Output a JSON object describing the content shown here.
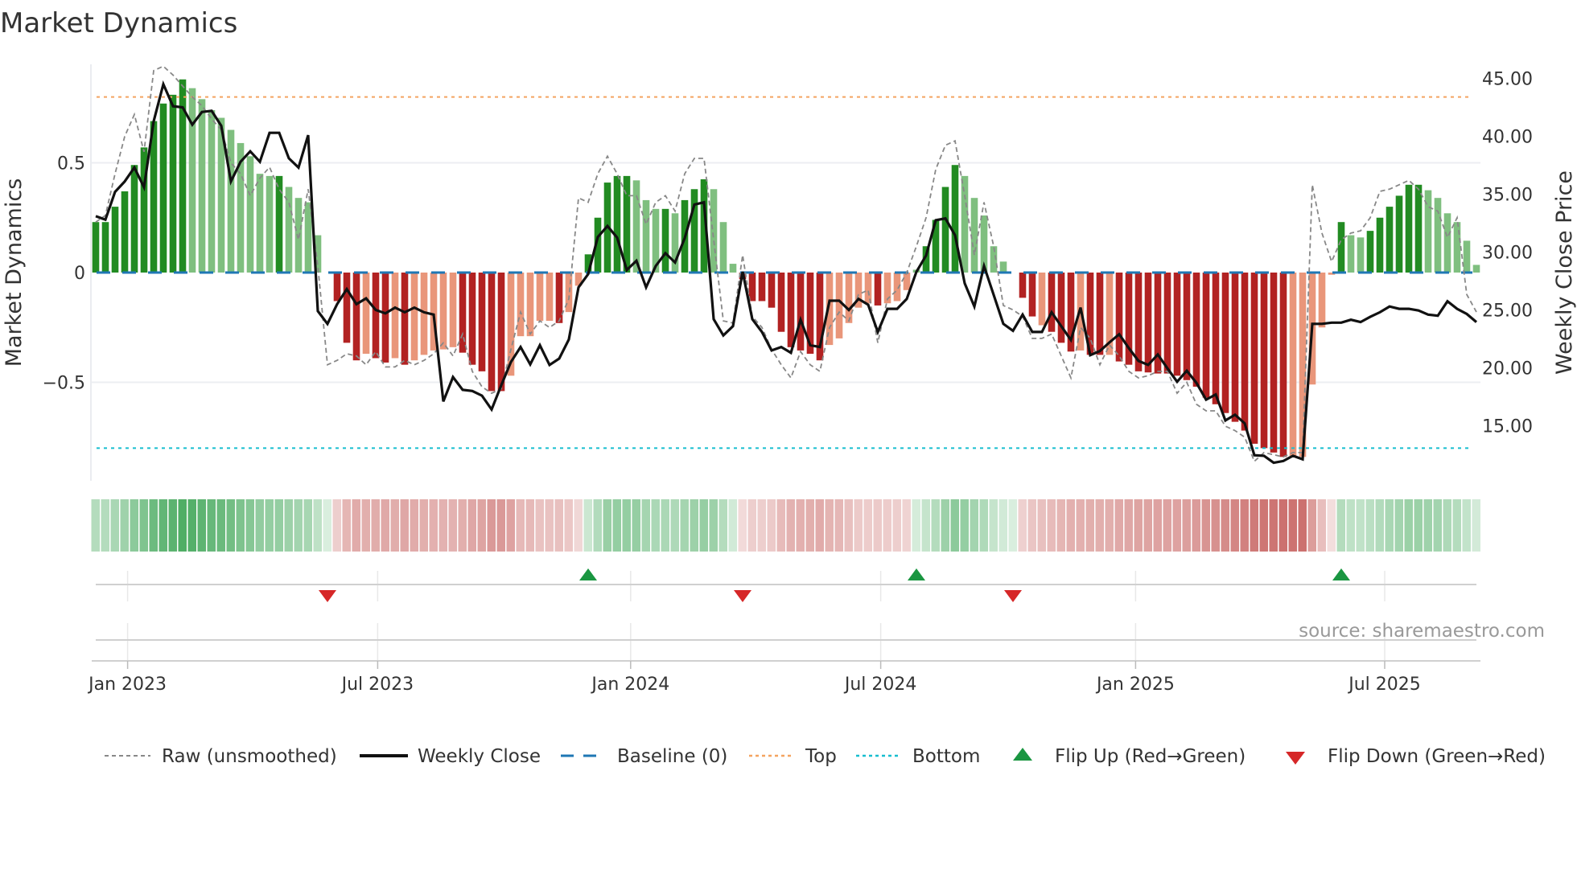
{
  "title": "Market Dynamics",
  "source": "source: sharemaestro.com",
  "colors": {
    "strong_green": "#228b22",
    "weak_green": "#7fbf7f",
    "strong_red": "#b22222",
    "weak_red": "#e9967a",
    "heat_green": "#2e9e48",
    "heat_red": "#c0504d",
    "raw": "#888888",
    "close": "#111111",
    "baseline": "#1f77b4",
    "top": "#f4a460",
    "bottom": "#17becf",
    "flip_up": "#1a9641",
    "flip_down": "#d62728"
  },
  "chart_data": {
    "type": "bar",
    "title": "Market Dynamics",
    "ylabel": "Market Dynamics",
    "ylabel_right": "Weekly Close Price",
    "ylim": [
      -0.95,
      0.95
    ],
    "ylim_right": [
      10.2,
      46.1
    ],
    "grid": true,
    "legend_position": "bottom",
    "x_unit": "week index",
    "y_ticks": [
      {
        "value": 0.5,
        "label": "0.5"
      },
      {
        "value": 0,
        "label": "0"
      },
      {
        "value": -0.5,
        "label": "−0.5"
      }
    ],
    "y_right_ticks": [
      {
        "value": 45,
        "label": "45.00"
      },
      {
        "value": 40,
        "label": "40.00"
      },
      {
        "value": 35,
        "label": "35.00"
      },
      {
        "value": 30,
        "label": "30.00"
      },
      {
        "value": 25,
        "label": "25.00"
      },
      {
        "value": 20,
        "label": "20.00"
      },
      {
        "value": 15,
        "label": "15.00"
      }
    ],
    "x_ticks": [
      {
        "week": 3.3,
        "label": "Jan 2023"
      },
      {
        "week": 29.2,
        "label": "Jul 2023"
      },
      {
        "week": 55.4,
        "label": "Jan 2024"
      },
      {
        "week": 81.3,
        "label": "Jul 2024"
      },
      {
        "week": 107.7,
        "label": "Jan 2025"
      },
      {
        "week": 133.5,
        "label": "Jul 2025"
      }
    ],
    "top_level": 0.8,
    "bottom_level": -0.8,
    "baseline": 0,
    "dynamics": [
      0.23,
      0.23,
      0.3,
      0.37,
      0.49,
      0.57,
      0.69,
      0.77,
      0.81,
      0.88,
      0.84,
      0.79,
      0.74,
      0.705,
      0.65,
      0.59,
      0.53,
      0.45,
      0.44,
      0.44,
      0.39,
      0.34,
      0.32,
      0.17,
      0,
      -0.13,
      -0.32,
      -0.4,
      -0.37,
      -0.39,
      -0.41,
      -0.39,
      -0.42,
      -0.4,
      -0.375,
      -0.355,
      -0.35,
      -0.34,
      -0.365,
      -0.42,
      -0.45,
      -0.54,
      -0.54,
      -0.47,
      -0.29,
      -0.29,
      -0.22,
      -0.22,
      -0.23,
      -0.18,
      -0.06,
      0.083,
      0.25,
      0.41,
      0.44,
      0.44,
      0.42,
      0.33,
      0.29,
      0.29,
      0.27,
      0.33,
      0.38,
      0.425,
      0.38,
      0.23,
      0.04,
      -0.03,
      -0.13,
      -0.13,
      -0.16,
      -0.27,
      -0.34,
      -0.355,
      -0.37,
      -0.4,
      -0.33,
      -0.3,
      -0.23,
      -0.16,
      -0.14,
      -0.15,
      -0.14,
      -0.13,
      -0.08,
      0.013,
      0.12,
      0.24,
      0.39,
      0.49,
      0.44,
      0.34,
      0.26,
      0.12,
      0.05,
      0,
      -0.115,
      -0.2,
      -0.24,
      -0.27,
      -0.32,
      -0.36,
      -0.355,
      -0.375,
      -0.375,
      -0.375,
      -0.405,
      -0.42,
      -0.45,
      -0.455,
      -0.46,
      -0.46,
      -0.47,
      -0.49,
      -0.52,
      -0.57,
      -0.6,
      -0.64,
      -0.68,
      -0.72,
      -0.78,
      -0.8,
      -0.82,
      -0.84,
      -0.835,
      -0.84,
      -0.51,
      -0.25,
      -0.01,
      0.23,
      0.17,
      0.16,
      0.19,
      0.25,
      0.3,
      0.35,
      0.4,
      0.4,
      0.375,
      0.34,
      0.27,
      0.23,
      0.145,
      0.035
    ],
    "strong": [
      1,
      1,
      1,
      1,
      1,
      1,
      1,
      1,
      1,
      1,
      0,
      0,
      0,
      0,
      0,
      0,
      0,
      0,
      0,
      1,
      0,
      0,
      0,
      0,
      0,
      1,
      1,
      1,
      0,
      1,
      1,
      0,
      1,
      0,
      0,
      0,
      0,
      0,
      1,
      1,
      1,
      1,
      1,
      0,
      0,
      0,
      0,
      0,
      1,
      0,
      0,
      1,
      1,
      1,
      1,
      1,
      0,
      0,
      0,
      1,
      0,
      1,
      1,
      1,
      0,
      0,
      0,
      1,
      1,
      1,
      1,
      1,
      1,
      1,
      1,
      1,
      0,
      0,
      0,
      0,
      0,
      1,
      0,
      0,
      0,
      0,
      1,
      1,
      1,
      1,
      0,
      0,
      0,
      0,
      0,
      0,
      1,
      1,
      0,
      1,
      1,
      1,
      0,
      1,
      1,
      0,
      1,
      1,
      1,
      1,
      1,
      1,
      1,
      1,
      1,
      1,
      1,
      1,
      1,
      1,
      1,
      1,
      1,
      1,
      0,
      0,
      0,
      0,
      0,
      1,
      0,
      0,
      1,
      1,
      1,
      1,
      1,
      1,
      0,
      0,
      0,
      0,
      0,
      0
    ],
    "raw": [
      0.23,
      0.26,
      0.45,
      0.62,
      0.72,
      0.55,
      0.92,
      0.94,
      0.9,
      0.85,
      0.8,
      0.76,
      0.7,
      0.65,
      0.5,
      0.45,
      0.35,
      0.43,
      0.48,
      0.38,
      0.32,
      0.15,
      0.38,
      0.03,
      -0.42,
      -0.4,
      -0.37,
      -0.38,
      -0.42,
      -0.36,
      -0.43,
      -0.43,
      -0.4,
      -0.42,
      -0.4,
      -0.37,
      -0.32,
      -0.38,
      -0.28,
      -0.45,
      -0.52,
      -0.55,
      -0.53,
      -0.35,
      -0.18,
      -0.28,
      -0.22,
      -0.25,
      -0.22,
      -0.12,
      0.34,
      0.32,
      0.45,
      0.53,
      0.45,
      0.35,
      0.35,
      0.22,
      0.32,
      0.35,
      0.28,
      0.45,
      0.52,
      0.52,
      0.15,
      -0.22,
      -0.23,
      0.08,
      -0.2,
      -0.25,
      -0.35,
      -0.42,
      -0.48,
      -0.36,
      -0.42,
      -0.45,
      -0.25,
      -0.18,
      -0.22,
      -0.1,
      -0.08,
      -0.32,
      -0.12,
      -0.08,
      0.0,
      0.12,
      0.25,
      0.47,
      0.58,
      0.6,
      0.35,
      0.08,
      0.32,
      0.12,
      -0.15,
      -0.17,
      -0.2,
      -0.3,
      -0.3,
      -0.28,
      -0.38,
      -0.48,
      -0.25,
      -0.3,
      -0.42,
      -0.33,
      -0.38,
      -0.45,
      -0.48,
      -0.47,
      -0.45,
      -0.45,
      -0.55,
      -0.5,
      -0.6,
      -0.63,
      -0.63,
      -0.7,
      -0.72,
      -0.75,
      -0.86,
      -0.82,
      -0.83,
      -0.84,
      -0.82,
      -0.82,
      0.4,
      0.18,
      0.05,
      0.15,
      0.18,
      0.19,
      0.25,
      0.37,
      0.38,
      0.4,
      0.42,
      0.38,
      0.3,
      0.28,
      0.16,
      0.25,
      -0.1,
      -0.18
    ],
    "weekly_close": [
      33.1,
      32.8,
      35.2,
      36.1,
      37.3,
      35.6,
      41.3,
      44.5,
      42.6,
      42.5,
      41.0,
      42.1,
      42.2,
      40.9,
      36.1,
      37.8,
      38.7,
      37.8,
      40.3,
      40.3,
      38.1,
      37.3,
      40.1,
      24.9,
      23.8,
      25.5,
      26.8,
      25.5,
      26.0,
      25.0,
      24.7,
      25.2,
      24.8,
      25.2,
      24.8,
      24.6,
      17.1,
      19.2,
      18.1,
      18.0,
      17.6,
      16.4,
      18.5,
      20.5,
      21.8,
      20.3,
      21.95,
      20.25,
      20.8,
      22.45,
      26.95,
      28.1,
      31.3,
      32.25,
      31.25,
      28.45,
      29.25,
      26.95,
      28.8,
      29.9,
      29.1,
      31.2,
      34.1,
      34.3,
      24.2,
      22.8,
      23.6,
      28.3,
      24.2,
      23.1,
      21.5,
      21.8,
      21.3,
      24.15,
      21.95,
      21.8,
      25.8,
      25.8,
      25.0,
      25.95,
      25.45,
      23.1,
      25.1,
      25.1,
      25.95,
      28.3,
      29.7,
      32.75,
      32.9,
      31.45,
      27.3,
      25.3,
      28.8,
      26.3,
      23.8,
      23.2,
      24.6,
      23.1,
      23.1,
      24.8,
      23.6,
      22.4,
      25.2,
      21.1,
      21.45,
      22.2,
      22.9,
      21.7,
      20.6,
      20.25,
      21.15,
      19.95,
      18.8,
      19.75,
      18.7,
      17.25,
      17.7,
      15.45,
      15.95,
      15.2,
      12.45,
      12.4,
      11.8,
      11.95,
      12.4,
      12.1,
      23.8,
      23.8,
      23.9,
      23.9,
      24.15,
      23.95,
      24.4,
      24.8,
      25.3,
      25.1,
      25.1,
      24.95,
      24.6,
      24.5,
      25.75,
      25.1,
      24.65,
      23.95
    ],
    "flip_up_weeks": [
      51,
      85,
      129
    ],
    "flip_down_weeks": [
      24,
      67,
      95
    ],
    "legend": [
      {
        "key": "raw",
        "label": "Raw (unsmoothed)"
      },
      {
        "key": "close",
        "label": "Weekly Close"
      },
      {
        "key": "baseline",
        "label": "Baseline (0)"
      },
      {
        "key": "top",
        "label": "Top"
      },
      {
        "key": "bottom",
        "label": "Bottom"
      },
      {
        "key": "flip_up",
        "label": "Flip Up (Red→Green)"
      },
      {
        "key": "flip_down",
        "label": "Flip Down (Green→Red)"
      }
    ]
  }
}
